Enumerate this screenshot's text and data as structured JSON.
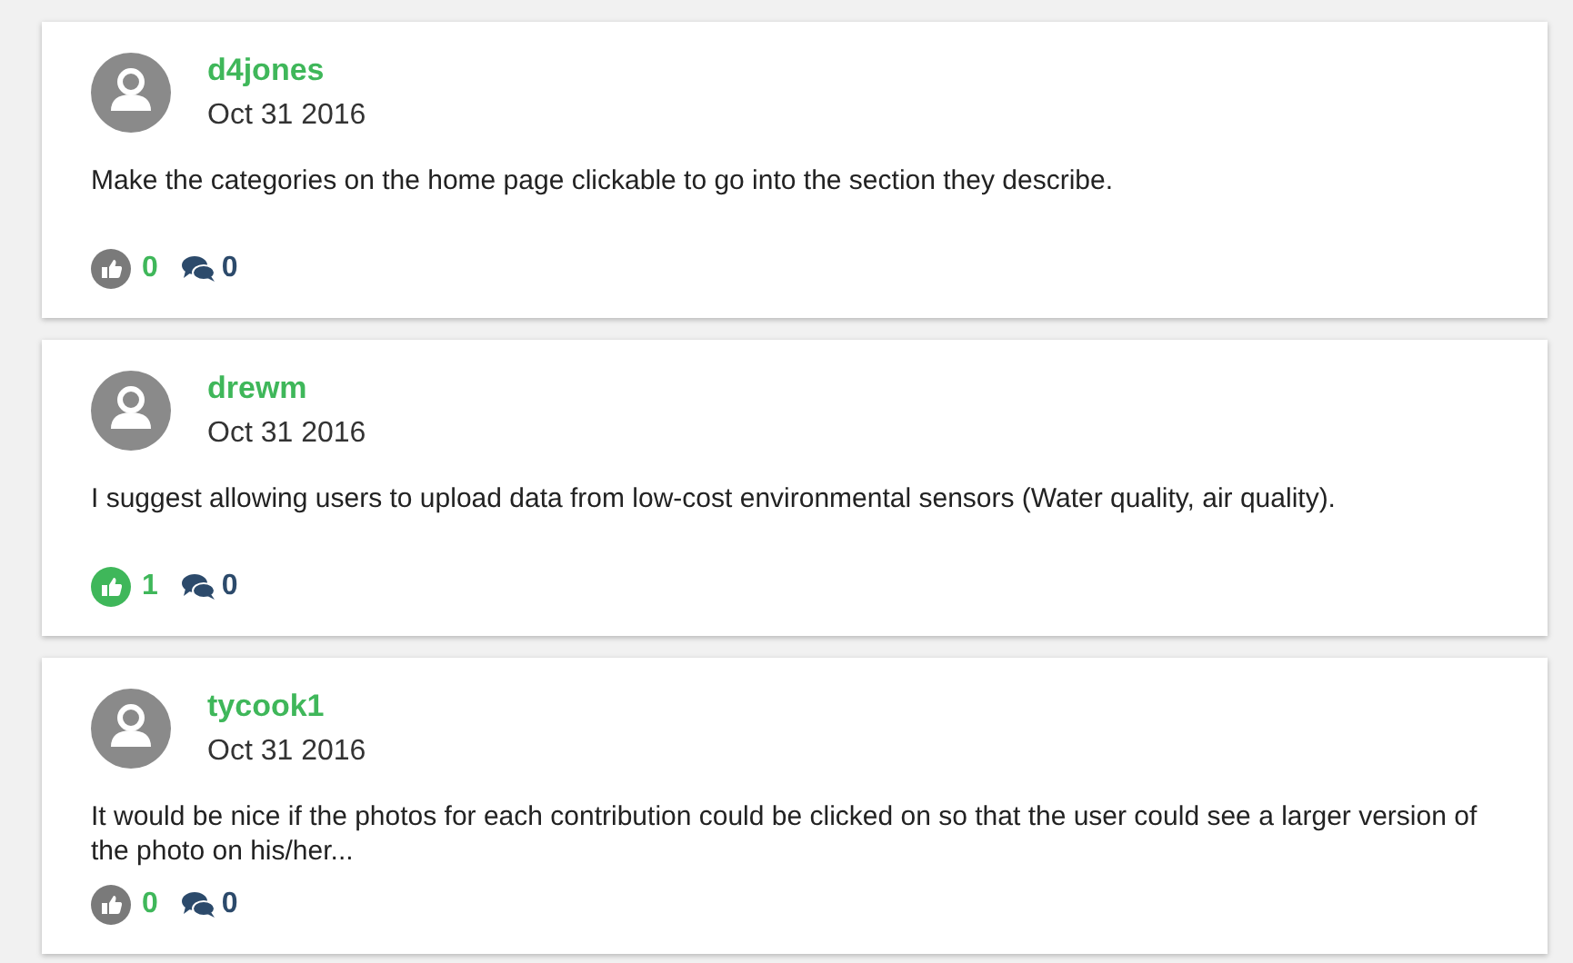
{
  "posts": [
    {
      "user": "d4jones",
      "date": "Oct 31 2016",
      "text": "Make the categories on the home page clickable to go into the section they describe.",
      "liked": false,
      "likes": "0",
      "comments": "0"
    },
    {
      "user": "drewm",
      "date": "Oct 31 2016",
      "text": "I suggest allowing users to upload data from low-cost environmental sensors (Water quality, air quality).",
      "liked": true,
      "likes": "1",
      "comments": "0"
    },
    {
      "user": "tycook1",
      "date": "Oct 31 2016",
      "text": "It would be nice if the photos for each contribution could be clicked on so that the user could see a larger version of the photo on his/her...",
      "liked": false,
      "likes": "0",
      "comments": "0"
    }
  ]
}
